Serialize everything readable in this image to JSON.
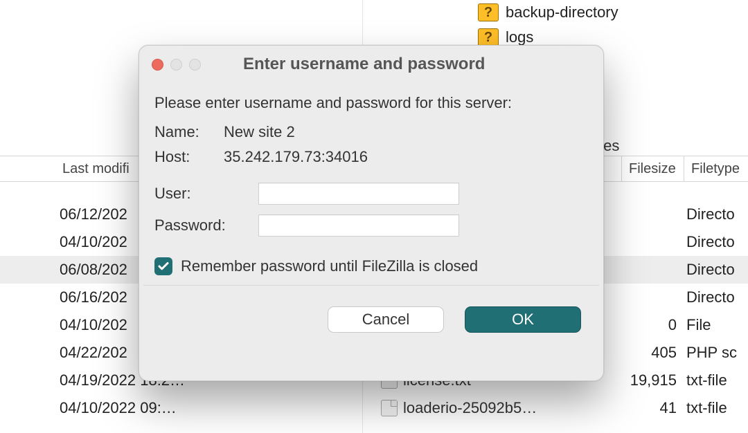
{
  "dialog": {
    "title": "Enter username and password",
    "intro": "Please enter username and password for this server:",
    "name_label": "Name:",
    "name_value": "New site 2",
    "host_label": "Host:",
    "host_value": "35.242.179.73:34016",
    "user_label": "User:",
    "user_value": "",
    "password_label": "Password:",
    "password_value": "",
    "remember_checked": true,
    "remember_label": "Remember password until FileZilla is closed",
    "cancel_label": "Cancel",
    "ok_label": "OK"
  },
  "bg_header": {
    "lastmod": "Last modifi",
    "tes_fragment": "tes",
    "filesize": "Filesize",
    "filetype": "Filetype"
  },
  "yellow_items": [
    {
      "label": "backup-directory"
    },
    {
      "label": "logs"
    }
  ],
  "rows": [
    {
      "date": "06/12/202",
      "name": "",
      "size": "",
      "type": "Directo",
      "sel": false
    },
    {
      "date": "04/10/202",
      "name": "",
      "size": "",
      "type": "Directo",
      "sel": false
    },
    {
      "date": "06/08/202",
      "name": "",
      "size": "",
      "type": "Directo",
      "sel": true
    },
    {
      "date": "06/16/202",
      "name": "",
      "size": "",
      "type": "Directo",
      "sel": false
    },
    {
      "date": "04/10/202",
      "name": "",
      "size": "0",
      "type": "File",
      "sel": false
    },
    {
      "date": "04/22/202",
      "name": "",
      "size": "405",
      "type": "PHP sc",
      "sel": false
    },
    {
      "date": "04/19/2022 18:2…",
      "name": "license.txt",
      "size": "19,915",
      "type": "txt-file",
      "sel": false
    },
    {
      "date": "04/10/2022 09:…",
      "name": "loaderio-25092b5…",
      "size": "41",
      "type": "txt-file",
      "sel": false
    }
  ]
}
